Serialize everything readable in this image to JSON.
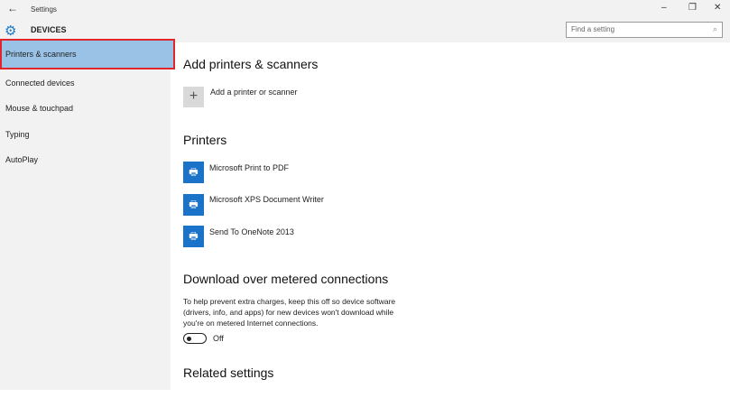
{
  "window": {
    "title": "Settings",
    "back_icon": "arrow-left-icon",
    "minimize": "–",
    "restore": "❐",
    "close": "✕"
  },
  "header": {
    "section": "DEVICES",
    "section_icon": "gear-icon",
    "search_placeholder": "Find a setting",
    "search_icon": "search-icon"
  },
  "sidebar": {
    "items": [
      {
        "label": "Printers & scanners",
        "selected": true
      },
      {
        "label": "Connected devices"
      },
      {
        "label": "Mouse & touchpad"
      },
      {
        "label": "Typing"
      },
      {
        "label": "AutoPlay"
      }
    ]
  },
  "main": {
    "add_heading": "Add printers & scanners",
    "add_label": "Add a printer or scanner",
    "add_icon": "+",
    "printers_heading": "Printers",
    "printers": [
      {
        "name": "Microsoft Print to PDF"
      },
      {
        "name": "Microsoft XPS Document Writer"
      },
      {
        "name": "Send To OneNote 2013"
      }
    ],
    "metered_heading": "Download over metered connections",
    "metered_desc": "To help prevent extra charges, keep this off so device software (drivers, info, and apps) for new devices won't download while you're on metered Internet connections.",
    "metered_toggle": {
      "state": "Off"
    },
    "related_heading": "Related settings"
  },
  "colors": {
    "accent": "#1a73c8",
    "selection": "#99c2e6",
    "highlight_border": "#e0262b"
  }
}
